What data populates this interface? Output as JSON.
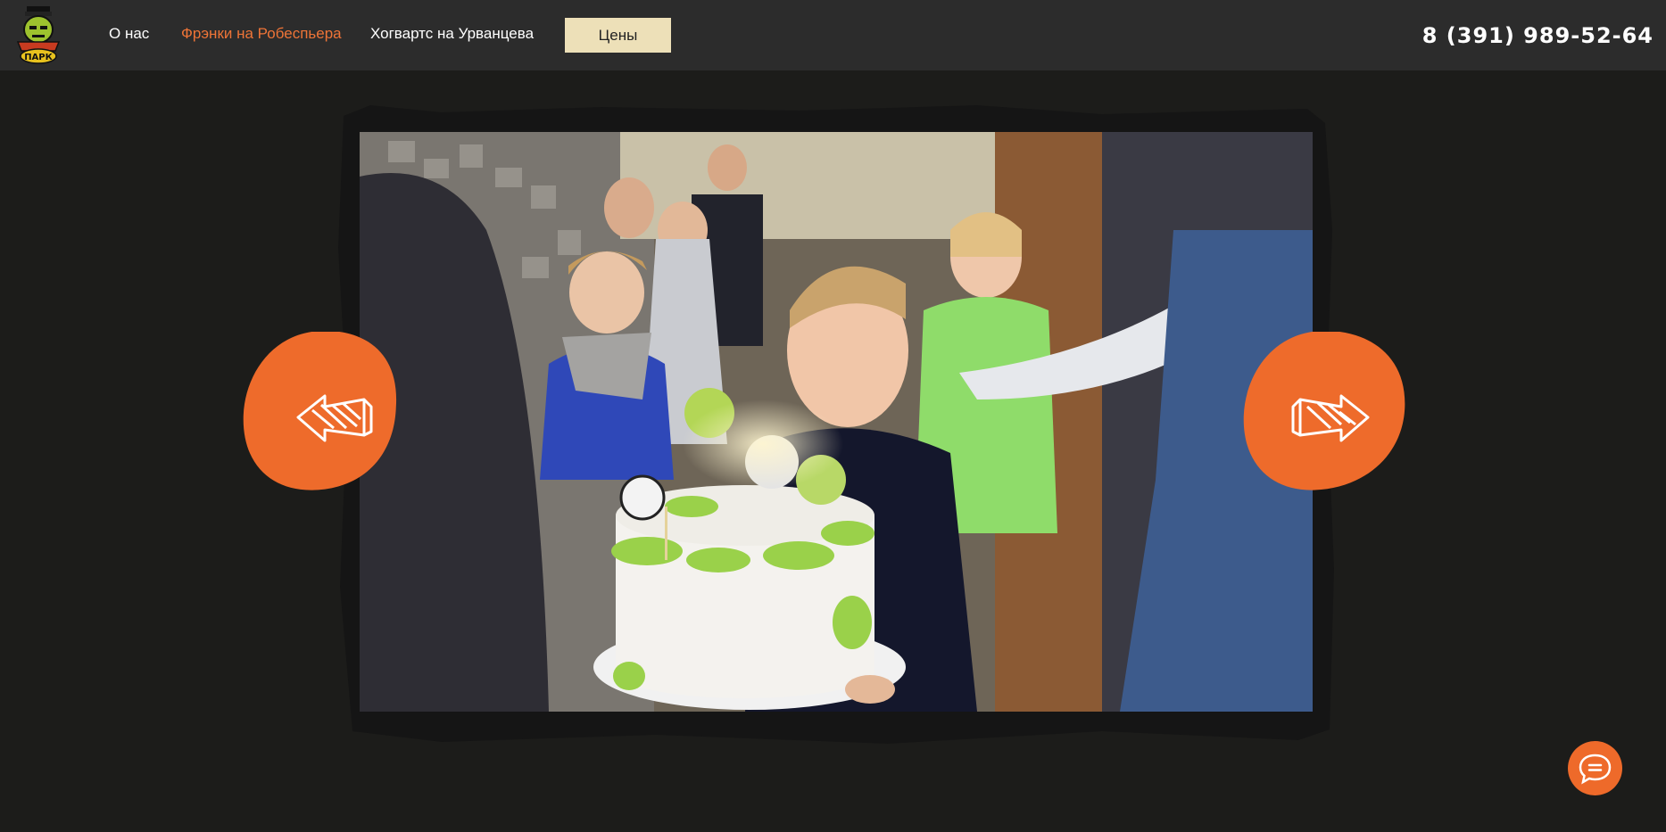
{
  "header": {
    "logo_text": "ПАРК",
    "nav": [
      {
        "label": "О нас"
      },
      {
        "label": "Фрэнки на Робеспьера"
      },
      {
        "label": "Хогвартс на Урванцева"
      }
    ],
    "prices_label": "Цены",
    "phone": "8 (391) 989-52-64"
  },
  "colors": {
    "accent": "#ee7437",
    "header_bg": "#2c2c2c",
    "page_bg": "#1c1c1a",
    "prices_bg": "#ede0b8",
    "arrow_bg": "#ee6b2b"
  },
  "slider": {
    "image": "boy-blowing-birthday-cake-candles",
    "prev_icon": "arrow-left-icon",
    "next_icon": "arrow-right-icon"
  },
  "chat": {
    "icon": "chat-bubble-icon"
  }
}
